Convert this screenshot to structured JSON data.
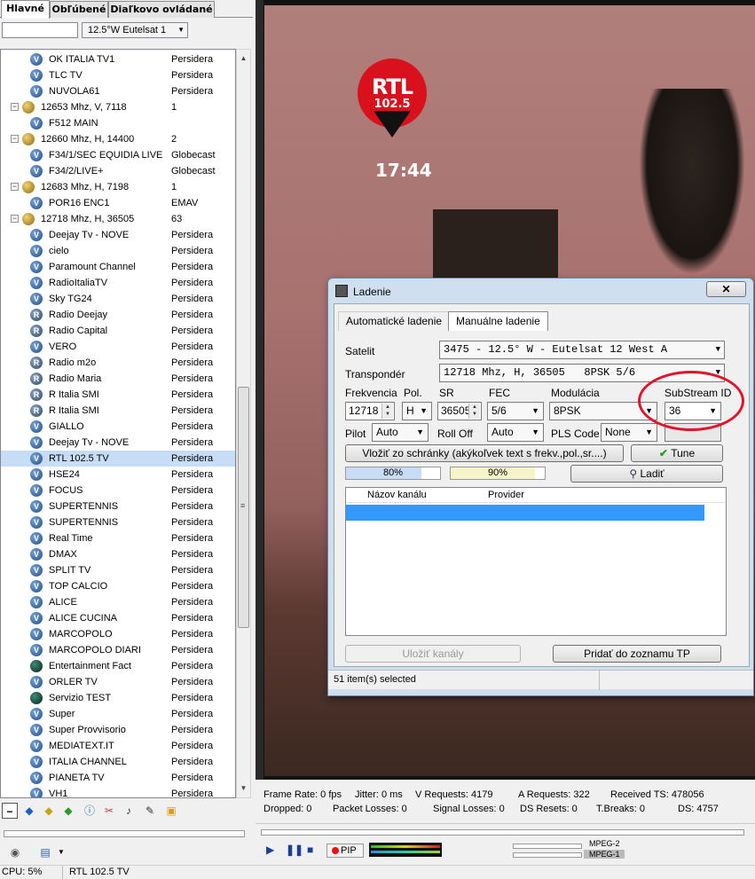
{
  "tabs": [
    "Hlavné",
    "Obľúbené",
    "Diaľkovo ovládané"
  ],
  "satellite_selector": {
    "search_value": "",
    "selected": "12.5°W Eutelsat 1"
  },
  "channels": [
    {
      "type": "ch",
      "icon": "v",
      "name": "OK ITALIA TV1",
      "prov": "Persidera"
    },
    {
      "type": "ch",
      "icon": "v",
      "name": "TLC TV",
      "prov": "Persidera"
    },
    {
      "type": "ch",
      "icon": "v",
      "name": "NUVOLA61",
      "prov": "Persidera"
    },
    {
      "type": "tp",
      "name": "12653 Mhz, V, 7118",
      "prov": "1"
    },
    {
      "type": "ch",
      "icon": "v",
      "name": "F512 MAIN",
      "prov": ""
    },
    {
      "type": "tp",
      "name": "12660 Mhz, H, 14400",
      "prov": "2"
    },
    {
      "type": "ch",
      "icon": "v",
      "name": "F34/1/SEC EQUIDIA LIVE",
      "prov": "Globecast"
    },
    {
      "type": "ch",
      "icon": "v",
      "name": "F34/2/LIVE+",
      "prov": "Globecast"
    },
    {
      "type": "tp",
      "name": "12683 Mhz, H, 7198",
      "prov": "1"
    },
    {
      "type": "ch",
      "icon": "v",
      "name": "POR16 ENC1",
      "prov": "EMAV"
    },
    {
      "type": "tp",
      "name": "12718 Mhz, H, 36505",
      "prov": "63"
    },
    {
      "type": "ch",
      "icon": "v",
      "name": "Deejay Tv - NOVE",
      "prov": "Persidera"
    },
    {
      "type": "ch",
      "icon": "v",
      "name": "cielo",
      "prov": "Persidera"
    },
    {
      "type": "ch",
      "icon": "v",
      "name": "Paramount Channel",
      "prov": "Persidera"
    },
    {
      "type": "ch",
      "icon": "v",
      "name": "RadioItaliaTV",
      "prov": "Persidera"
    },
    {
      "type": "ch",
      "icon": "v",
      "name": "Sky TG24",
      "prov": "Persidera"
    },
    {
      "type": "ch",
      "icon": "r",
      "name": "Radio Deejay",
      "prov": "Persidera"
    },
    {
      "type": "ch",
      "icon": "r",
      "name": "Radio Capital",
      "prov": "Persidera"
    },
    {
      "type": "ch",
      "icon": "v",
      "name": "VERO",
      "prov": "Persidera"
    },
    {
      "type": "ch",
      "icon": "r",
      "name": "Radio m2o",
      "prov": "Persidera"
    },
    {
      "type": "ch",
      "icon": "r",
      "name": "Radio Maria",
      "prov": "Persidera"
    },
    {
      "type": "ch",
      "icon": "r",
      "name": "R Italia SMI",
      "prov": "Persidera"
    },
    {
      "type": "ch",
      "icon": "r",
      "name": "R Italia SMI",
      "prov": "Persidera"
    },
    {
      "type": "ch",
      "icon": "v",
      "name": "GIALLO",
      "prov": "Persidera"
    },
    {
      "type": "ch",
      "icon": "v",
      "name": "Deejay Tv - NOVE",
      "prov": "Persidera"
    },
    {
      "type": "ch",
      "icon": "v",
      "name": "RTL 102.5 TV",
      "prov": "Persidera",
      "selected": true
    },
    {
      "type": "ch",
      "icon": "v",
      "name": "HSE24",
      "prov": "Persidera"
    },
    {
      "type": "ch",
      "icon": "v",
      "name": "FOCUS",
      "prov": "Persidera"
    },
    {
      "type": "ch",
      "icon": "v",
      "name": "SUPERTENNIS",
      "prov": "Persidera"
    },
    {
      "type": "ch",
      "icon": "v",
      "name": "SUPERTENNIS",
      "prov": "Persidera"
    },
    {
      "type": "ch",
      "icon": "v",
      "name": "Real Time",
      "prov": "Persidera"
    },
    {
      "type": "ch",
      "icon": "v",
      "name": "DMAX",
      "prov": "Persidera"
    },
    {
      "type": "ch",
      "icon": "v",
      "name": "SPLIT TV",
      "prov": "Persidera"
    },
    {
      "type": "ch",
      "icon": "v",
      "name": "TOP CALCIO",
      "prov": "Persidera"
    },
    {
      "type": "ch",
      "icon": "v",
      "name": "ALICE",
      "prov": "Persidera"
    },
    {
      "type": "ch",
      "icon": "v",
      "name": "ALICE CUCINA",
      "prov": "Persidera"
    },
    {
      "type": "ch",
      "icon": "v",
      "name": "MARCOPOLO",
      "prov": "Persidera"
    },
    {
      "type": "ch",
      "icon": "v",
      "name": "MARCOPOLO DIARI",
      "prov": "Persidera"
    },
    {
      "type": "ch",
      "icon": "dk",
      "name": "Entertainment Fact",
      "prov": "Persidera"
    },
    {
      "type": "ch",
      "icon": "v",
      "name": "ORLER TV",
      "prov": "Persidera"
    },
    {
      "type": "ch",
      "icon": "dk",
      "name": "Servizio TEST",
      "prov": "Persidera"
    },
    {
      "type": "ch",
      "icon": "v",
      "name": "Super",
      "prov": "Persidera"
    },
    {
      "type": "ch",
      "icon": "v",
      "name": "Super Provvisorio",
      "prov": "Persidera"
    },
    {
      "type": "ch",
      "icon": "v",
      "name": "MEDIATEXT.IT",
      "prov": "Persidera"
    },
    {
      "type": "ch",
      "icon": "v",
      "name": "ITALIA CHANNEL",
      "prov": "Persidera"
    },
    {
      "type": "ch",
      "icon": "v",
      "name": "PIANETA TV",
      "prov": "Persidera"
    },
    {
      "type": "ch",
      "icon": "v",
      "name": "VH1",
      "prov": "Persidera"
    }
  ],
  "video": {
    "logo_text": "RTL",
    "logo_freq": "102.5",
    "clock": "17:44"
  },
  "stats": {
    "frame_rate": "Frame Rate: 0 fps",
    "jitter": "Jitter: 0 ms",
    "v_requests": "V Requests: 4179",
    "a_requests": "A Requests: 322",
    "received_ts": "Received TS: 478056",
    "dropped": "Dropped: 0",
    "packet_losses": "Packet Losses: 0",
    "signal_losses": "Signal Losses: 0",
    "ds_resets": "DS Resets: 0",
    "t_breaks": "T.Breaks: 0",
    "ds": "DS: 4757"
  },
  "player": {
    "pip_label": "PIP",
    "fmt1": "MPEG-2",
    "fmt2": "MPEG-1"
  },
  "statusbar": {
    "cpu": "CPU: 5%",
    "channel": "RTL 102.5 TV"
  },
  "dialog": {
    "title": "Ladenie",
    "close": "✕",
    "tab_auto": "Automatické ladenie",
    "tab_manual": "Manuálne ladenie",
    "satelit_label": "Satelit",
    "satelit_value": "3475 - 12.5° W - Eutelsat 12 West A",
    "transponder_label": "Transpondér",
    "transponder_value": "12718 Mhz, H, 36505   8PSK 5/6",
    "freq_label": "Frekvencia",
    "freq_value": "12718",
    "pol_label": "Pol.",
    "pol_value": "H",
    "sr_label": "SR",
    "sr_value": "36505",
    "fec_label": "FEC",
    "fec_value": "5/6",
    "mod_label": "Modulácia",
    "mod_value": "8PSK",
    "substream_label": "SubStream ID",
    "substream_value": "36",
    "pilot_label": "Pilot",
    "pilot_value": "Auto",
    "rolloff_label": "Roll Off",
    "rolloff_value": "Auto",
    "pls_label": "PLS Code",
    "pls_value": "None",
    "paste_button": "Vložiť zo schránky  (akýkoľvek text s frekv.,pol.,sr....)",
    "tune_button": "Tune",
    "signal_strength": "80%",
    "signal_quality": "90%",
    "ladit_button": "Ladiť",
    "col_channel": "Názov kanálu",
    "col_provider": "Provider",
    "save_button": "Uložiť kanály",
    "add_tp_button": "Pridať do zoznamu TP",
    "status": "51 item(s) selected"
  },
  "colors": {
    "selection": "#c7ddf5",
    "highlight_circle": "#e0142a",
    "row_selected": "#3399ff"
  },
  "levels": {
    "signal_strength": 0.8,
    "signal_quality": 0.9
  }
}
